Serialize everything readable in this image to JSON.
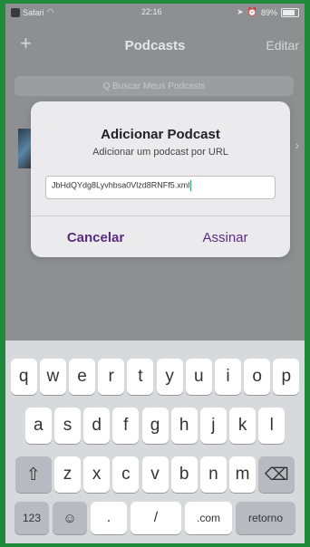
{
  "status": {
    "carrier": "Safari",
    "time": "22:16",
    "battery": "89%"
  },
  "nav": {
    "plus": "+",
    "title": "Podcasts",
    "edit": "Editar"
  },
  "search": {
    "placeholder": "Q Buscar Meus Podcasts"
  },
  "alert": {
    "title": "Adicionar Podcast",
    "subtitle": "Adicionar um podcast por URL",
    "url_value": "JbHdQYdg8Lyvhbsa0Vlzd8RNFf5.xml",
    "cancel": "Cancelar",
    "subscribe": "Assinar"
  },
  "keyboard": {
    "row1": [
      "q",
      "w",
      "e",
      "r",
      "t",
      "y",
      "u",
      "i",
      "o",
      "p"
    ],
    "row2": [
      "a",
      "s",
      "d",
      "f",
      "g",
      "h",
      "j",
      "k",
      "l"
    ],
    "row3": [
      "z",
      "x",
      "c",
      "v",
      "b",
      "n",
      "m"
    ],
    "shift": "⇧",
    "backspace": "⌫",
    "k123": "123",
    "emoji": "☺",
    "dot": ".",
    "slash": "/",
    "com": ".com",
    "return": "retorno"
  }
}
